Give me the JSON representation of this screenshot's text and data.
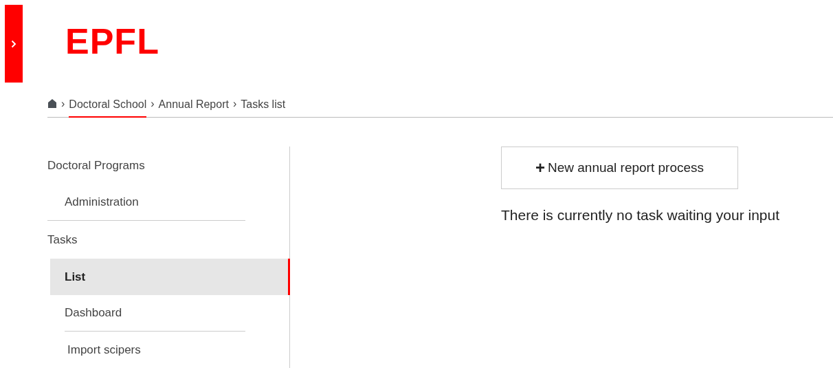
{
  "header": {
    "logo": "EPFL"
  },
  "breadcrumb": [
    {
      "label": "Doctoral School",
      "selected": true
    },
    {
      "label": "Annual Report",
      "selected": false
    },
    {
      "label": "Tasks list",
      "selected": false
    }
  ],
  "separator": "›",
  "sidebar": {
    "sections": [
      {
        "title": "Doctoral Programs",
        "items": [
          {
            "label": "Administration",
            "selected": false
          }
        ]
      },
      {
        "title": "Tasks",
        "items": [
          {
            "label": "List",
            "selected": true
          },
          {
            "label": "Dashboard",
            "selected": false
          },
          {
            "label": "Import scipers",
            "selected": false
          }
        ]
      }
    ]
  },
  "main": {
    "button": {
      "icon": "+",
      "label": "New annual report process"
    },
    "message": "There is currently no task waiting your input"
  }
}
